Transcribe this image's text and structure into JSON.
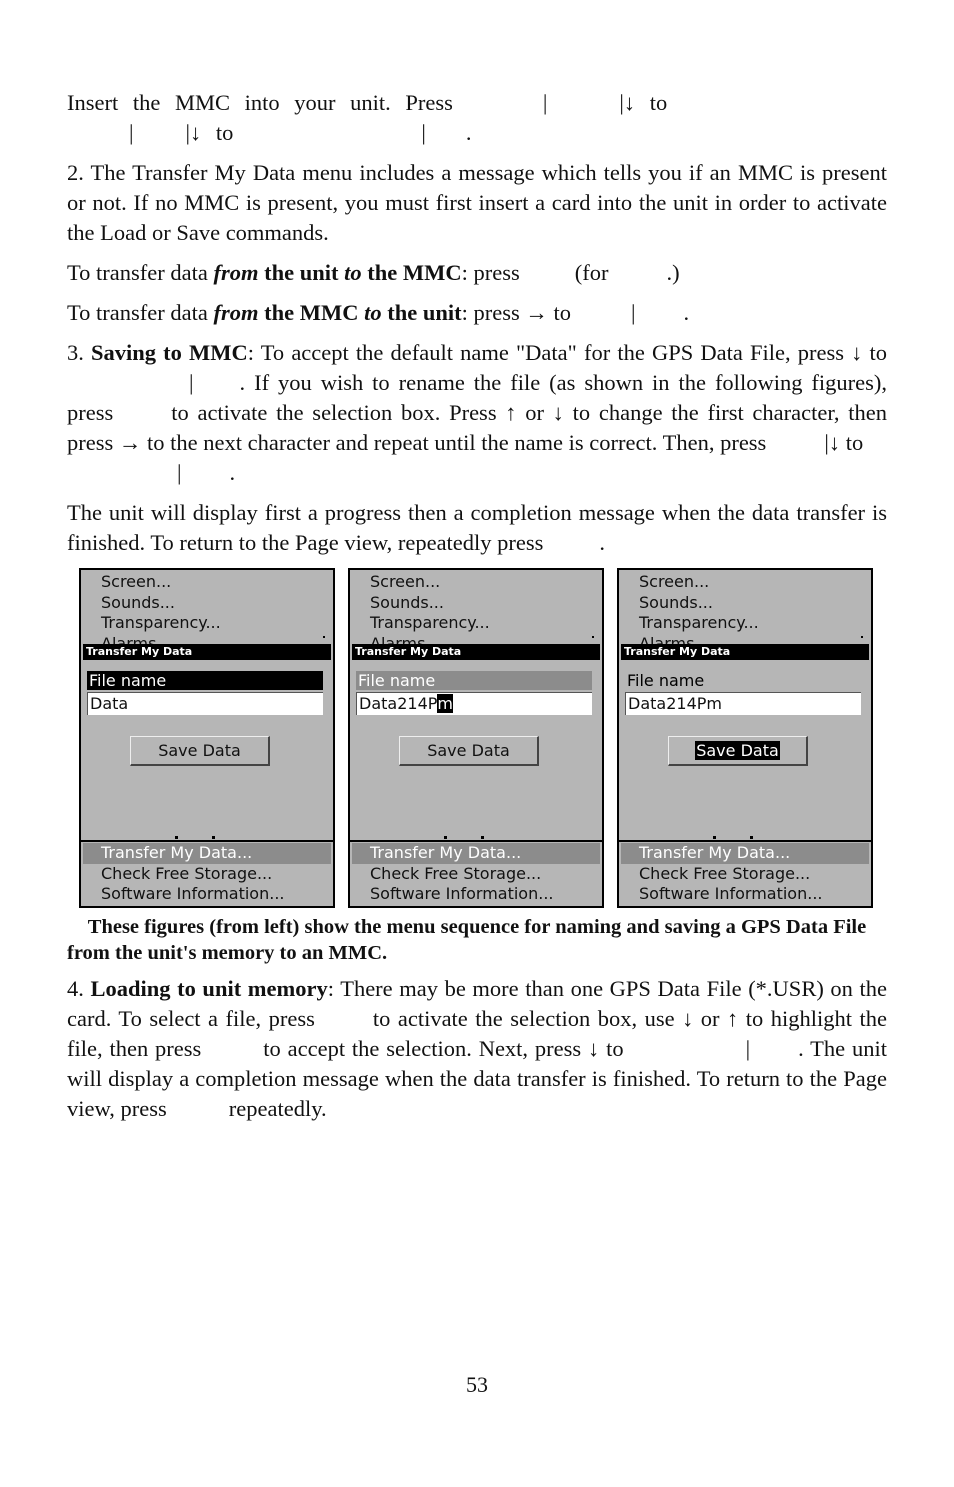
{
  "paragraphs": {
    "p1_line1_a": "Insert the MMC into your unit. Press",
    "p1_line1_b": "|",
    "p1_line1_c": "|↓ to",
    "p1_line2_a": "|",
    "p1_line2_b": "|↓ to",
    "p1_line2_c": "|",
    "p1_line2_d": ".",
    "p2": "2. The Transfer My Data menu includes a message which tells you if an MMC is present or not. If no MMC is present, you must first insert a card into the unit in order to activate the Load or Save commands.",
    "p3": {
      "a": "To transfer data ",
      "from": "from",
      "b": " the unit ",
      "to": "to",
      "c": " the MMC",
      "d": ": press",
      "e": "(for",
      "f": ".)"
    },
    "p4": {
      "a": "To transfer data ",
      "from": "from",
      "b": " the MMC ",
      "to": "to",
      "c": " the unit",
      "d": ": press → to",
      "e": "|",
      "f": "."
    },
    "p5": {
      "num": "3. ",
      "heading": "Saving to MMC",
      "t1": ": To accept the default name \"Data\" for the GPS Data File, press ↓ to",
      "t2": "|",
      "t3": ". If you wish to rename the file (as shown in the following figures), press",
      "t4": "to activate the selection box. Press ↑ or ↓ to change the first character, then press → to the next character and repeat until the name is correct. Then, press",
      "t5": "|↓ to",
      "t6": "|",
      "t7": "."
    },
    "p6": {
      "a": "The unit will display first a progress then a completion message when the data transfer is finished. To return to the Page view, repeatedly press",
      "b": "."
    },
    "caption": "These figures (from left) show the menu sequence for naming and saving a GPS Data File from the unit's memory to an MMC.",
    "p7": {
      "num": "4. ",
      "heading": "Loading to unit memory",
      "t1": ": There may be more than one GPS Data File (*.USR) on the card. To select a file, press",
      "t2": "to activate the selection box, use ↓ or ↑ to highlight the file, then press",
      "t3": "to accept the selection. Next, press ↓ to",
      "t4": "|",
      "t5": ". The unit will display a completion message when the data transfer is finished. To return to the Page view, press",
      "t6": "repeatedly."
    }
  },
  "screens": [
    {
      "menu_top": [
        "Screen...",
        "Sounds...",
        "Transparency...",
        "Alarms..."
      ],
      "dialog_title": "Transfer My Data",
      "file_name_label": "File name",
      "file_name_state": "selected",
      "file_name_value": "Data",
      "cursor_char": "",
      "save_button": "Save Data",
      "save_highlighted": false,
      "menu_bottom": [
        "Transfer My Data...",
        "Check Free Storage...",
        "Software Information..."
      ],
      "menu_bottom_selected": 0
    },
    {
      "menu_top": [
        "Screen...",
        "Sounds...",
        "Transparency...",
        "Alarms..."
      ],
      "dialog_title": "Transfer My Data",
      "file_name_label": "File name",
      "file_name_state": "editing",
      "file_name_value": "Data214P",
      "cursor_char": "m",
      "save_button": "Save Data",
      "save_highlighted": false,
      "menu_bottom": [
        "Transfer My Data...",
        "Check Free Storage...",
        "Software Information..."
      ],
      "menu_bottom_selected": 0
    },
    {
      "menu_top": [
        "Screen...",
        "Sounds...",
        "Transparency...",
        "Alarms..."
      ],
      "dialog_title": "Transfer My Data",
      "file_name_label": "File name",
      "file_name_state": "normal",
      "file_name_value": "Data214Pm",
      "cursor_char": "",
      "save_button": "Save Data",
      "save_highlighted": true,
      "menu_bottom": [
        "Transfer My Data...",
        "Check Free Storage...",
        "Software Information..."
      ],
      "menu_bottom_selected": 0
    }
  ],
  "page_number": "53"
}
